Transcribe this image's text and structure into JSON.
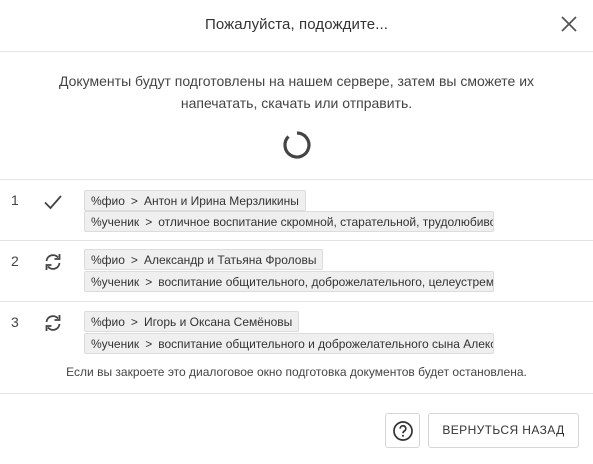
{
  "dialog": {
    "title": "Пожалуйста, подождите...",
    "description_line1": "Документы будут подготовлены на нашем сервере, затем вы сможете их",
    "description_line2": "напечатать, скачать или отправить.",
    "note": "Если вы закроете это диалоговое окно подготовка документов будет остановлена."
  },
  "icons": {
    "close": "close-icon",
    "spinner": "loading-spinner-icon",
    "done": "checkmark-icon",
    "pending": "sync-icon",
    "help": "question-circle-icon"
  },
  "rows": [
    {
      "num": "1",
      "status": "done",
      "tags": [
        {
          "key": "%фио",
          "value": "Антон и Ирина Мерзликины"
        },
        {
          "key": "%ученик",
          "value": "отличное воспитание скромной, старательной, трудолюбивой"
        }
      ]
    },
    {
      "num": "2",
      "status": "pending",
      "tags": [
        {
          "key": "%фио",
          "value": "Александр и Татьяна Фроловы"
        },
        {
          "key": "%ученик",
          "value": "воспитание общительного, доброжелательного, целеустремлённого"
        }
      ]
    },
    {
      "num": "3",
      "status": "pending",
      "tags": [
        {
          "key": "%фио",
          "value": "Игорь и Оксана Семёновы"
        },
        {
          "key": "%ученик",
          "value": "воспитание общительного и доброжелательного сына Алексея"
        }
      ]
    }
  ],
  "footer": {
    "back_label": "ВЕРНУТЬСЯ НАЗАД"
  },
  "colors": {
    "text": "#333333",
    "divider": "#e3e3e3",
    "tag_bg": "#efefef"
  }
}
